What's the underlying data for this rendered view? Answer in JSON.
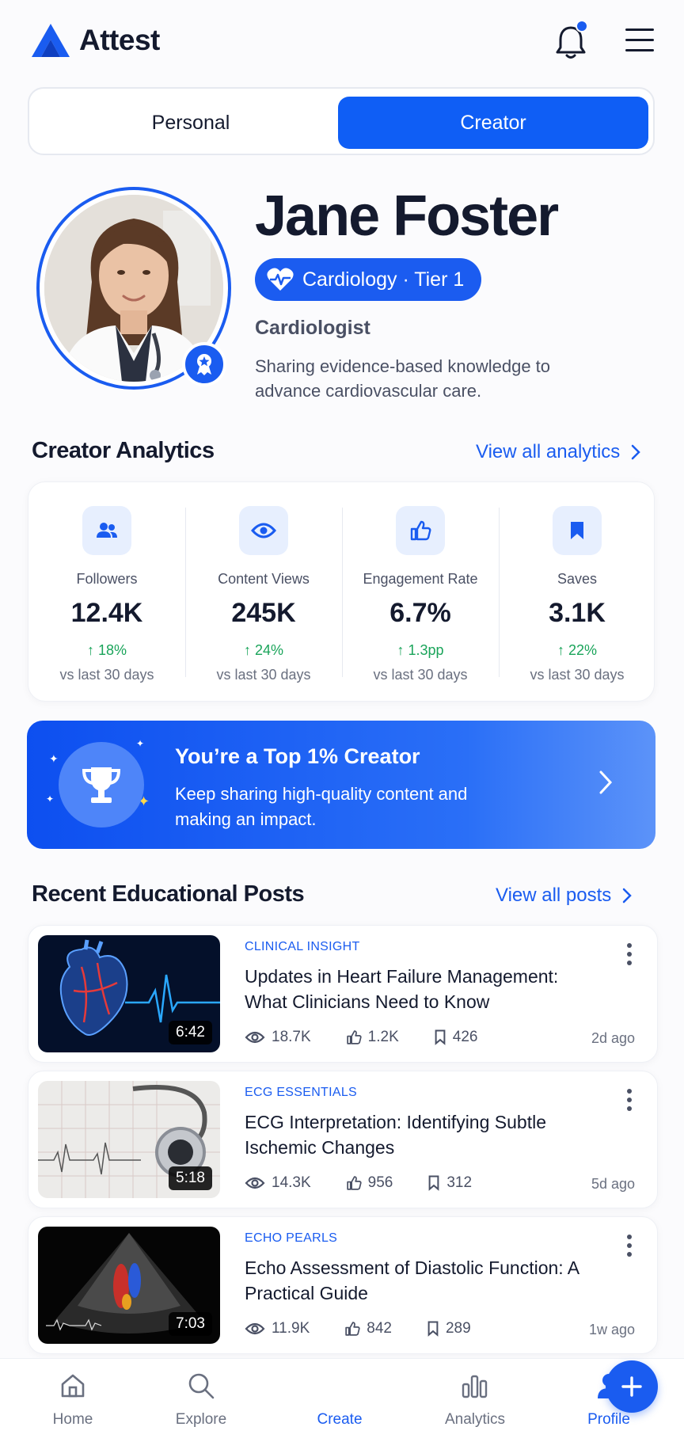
{
  "app": {
    "name": "Attest"
  },
  "toggle": {
    "personal": "Personal",
    "creator": "Creator",
    "selected": "Creator"
  },
  "profile": {
    "name": "Jane Foster",
    "specialty": "Cardiology · Tier 1",
    "role": "Cardiologist",
    "bio": "Sharing evidence-based knowledge to advance cardiovascular care."
  },
  "analytics": {
    "title": "Creator Analytics",
    "link": "View all analytics",
    "stats": [
      {
        "label": "Followers",
        "value": "12.4K",
        "delta": "18%",
        "sub": "vs last 30 days",
        "icon": "users-icon"
      },
      {
        "label": "Content Views",
        "value": "245K",
        "delta": "24%",
        "sub": "vs last 30 days",
        "icon": "eye-icon"
      },
      {
        "label": "Engagement Rate",
        "value": "6.7%",
        "delta": "1.3pp",
        "sub": "vs last 30 days",
        "icon": "thumbs-up-icon"
      },
      {
        "label": "Saves",
        "value": "3.1K",
        "delta": "22%",
        "sub": "vs last 30 days",
        "icon": "bookmark-icon"
      }
    ]
  },
  "banner": {
    "title": "You’re a Top 1% Creator",
    "text": "Keep sharing high-quality content and making an impact."
  },
  "posts": {
    "title": "Recent Educational Posts",
    "link": "View all posts",
    "items": [
      {
        "category": "CLINICAL INSIGHT",
        "title": "Updates in Heart Failure Management: What Clinicians Need to Know",
        "duration": "6:42",
        "views": "18.7K",
        "likes": "1.2K",
        "saves": "426",
        "time": "2d ago"
      },
      {
        "category": "ECG ESSENTIALS",
        "title": "ECG Interpretation: Identifying Subtle Ischemic Changes",
        "duration": "5:18",
        "views": "14.3K",
        "likes": "956",
        "saves": "312",
        "time": "5d ago"
      },
      {
        "category": "ECHO PEARLS",
        "title": "Echo Assessment of Diastolic Function: A Practical Guide",
        "duration": "7:03",
        "views": "11.9K",
        "likes": "842",
        "saves": "289",
        "time": "1w ago"
      }
    ]
  },
  "nav": {
    "items": [
      {
        "label": "Home",
        "icon": "home-icon"
      },
      {
        "label": "Explore",
        "icon": "search-icon"
      },
      {
        "label": "Create",
        "icon": "plus-icon"
      },
      {
        "label": "Analytics",
        "icon": "bar-chart-icon"
      },
      {
        "label": "Profile",
        "icon": "person-icon"
      }
    ],
    "active": "Profile"
  },
  "colors": {
    "accent": "#1a5cf0",
    "positive": "#1aa45a",
    "text": "#141a2e"
  }
}
